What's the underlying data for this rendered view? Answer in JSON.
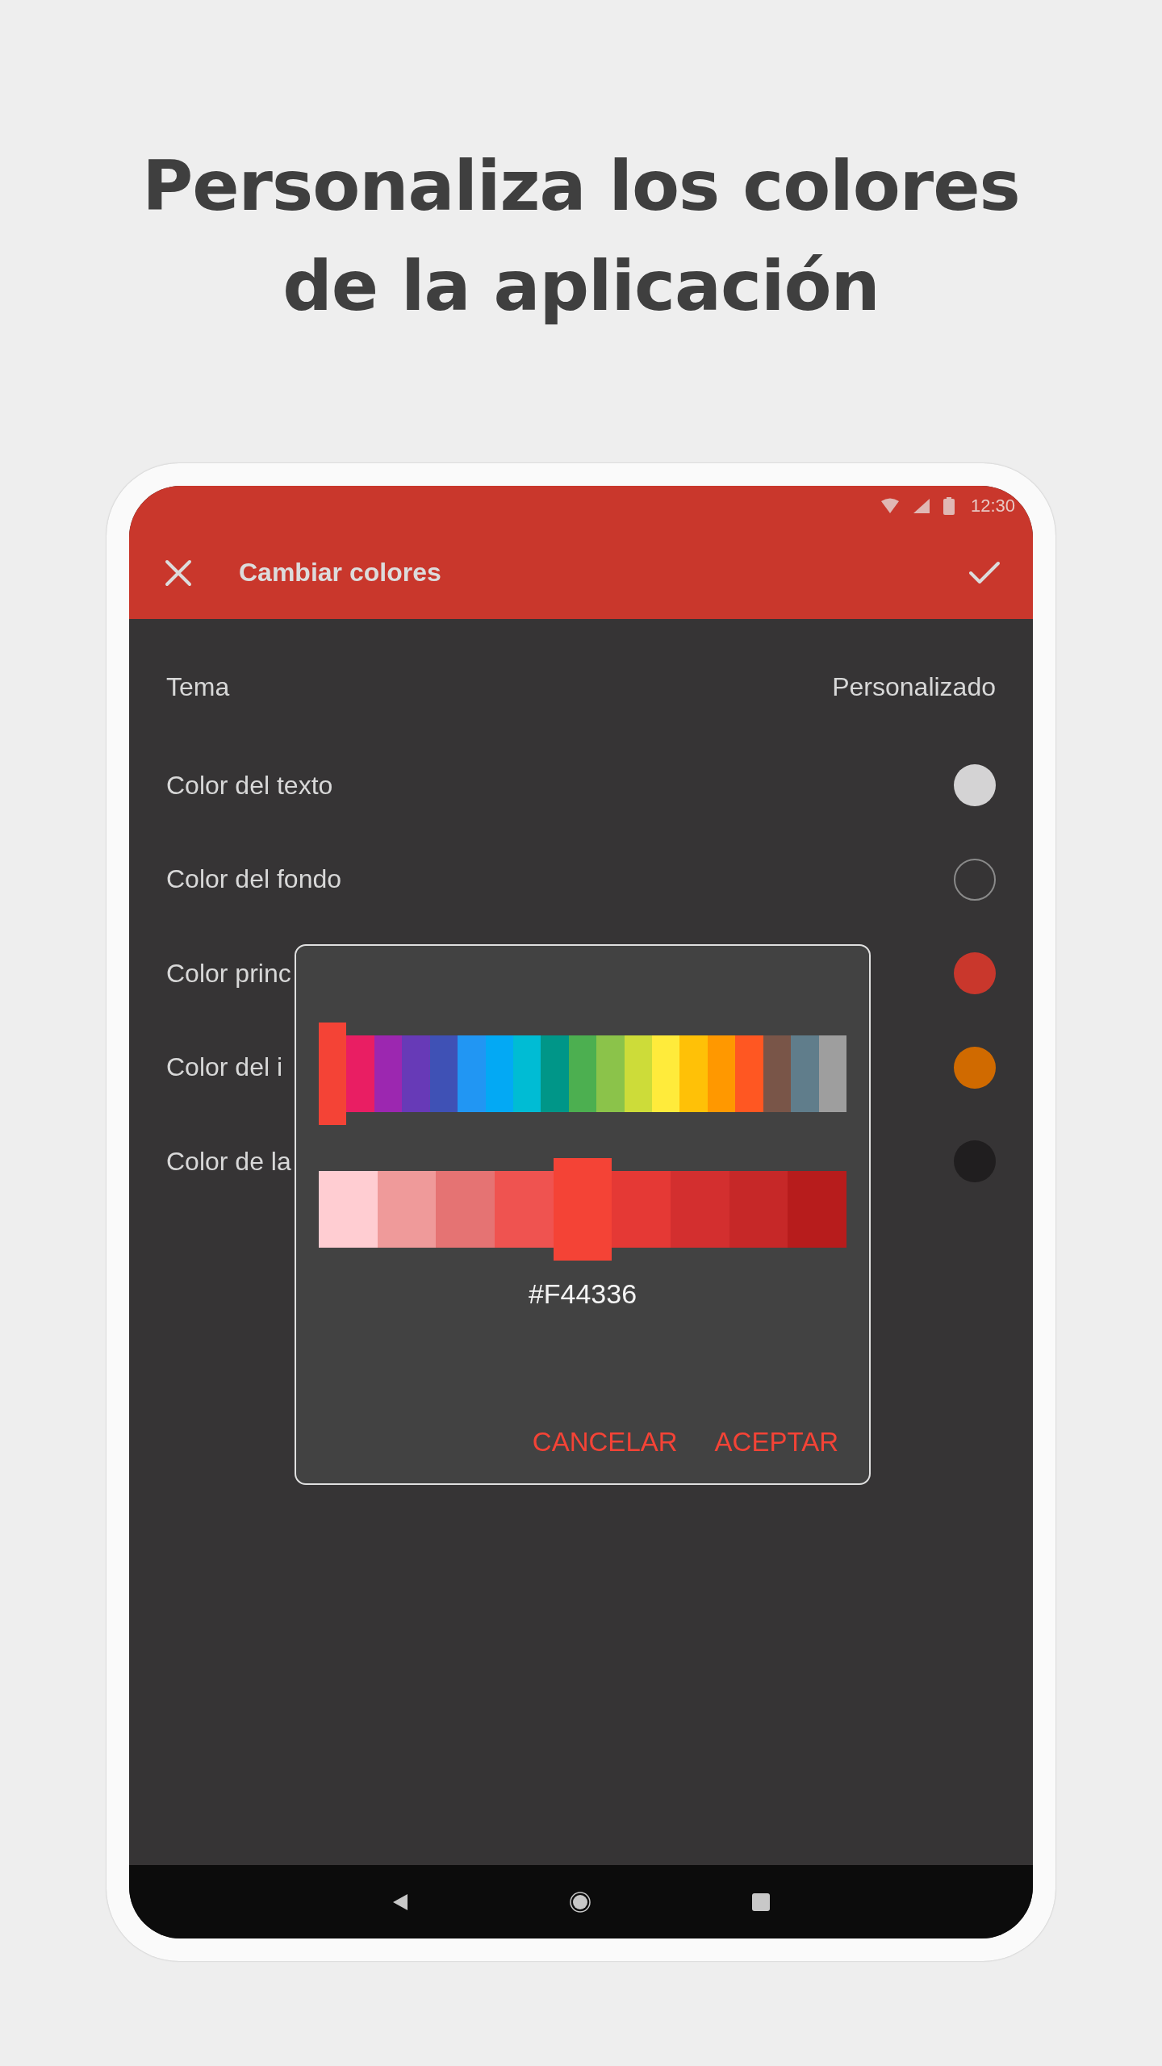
{
  "headline": "Personaliza los colores de la aplicación",
  "status_bar": {
    "time": "12:30"
  },
  "app_bar": {
    "title": "Cambiar colores"
  },
  "settings": [
    {
      "kind": "value",
      "label": "Tema",
      "value": "Personalizado"
    },
    {
      "kind": "swatch",
      "label": "Color del texto",
      "color": "#d4d3d4"
    },
    {
      "kind": "outline",
      "label": "Color del fondo",
      "color": "#363435"
    },
    {
      "kind": "swatch",
      "label": "Color princ",
      "color": "#c9372c"
    },
    {
      "kind": "swatch",
      "label": "Color del i",
      "color": "#d06a00"
    },
    {
      "kind": "swatch",
      "label": "Color de la",
      "color": "#201e1f"
    }
  ],
  "dialog": {
    "hues": [
      {
        "color": "#f44336",
        "selected": true
      },
      {
        "color": "#e91e63",
        "selected": false
      },
      {
        "color": "#9c27b0",
        "selected": false
      },
      {
        "color": "#673ab7",
        "selected": false
      },
      {
        "color": "#3f51b5",
        "selected": false
      },
      {
        "color": "#2196f3",
        "selected": false
      },
      {
        "color": "#03a9f4",
        "selected": false
      },
      {
        "color": "#00bcd4",
        "selected": false
      },
      {
        "color": "#009688",
        "selected": false
      },
      {
        "color": "#4caf50",
        "selected": false
      },
      {
        "color": "#8bc34a",
        "selected": false
      },
      {
        "color": "#cddc39",
        "selected": false
      },
      {
        "color": "#ffeb3b",
        "selected": false
      },
      {
        "color": "#ffc107",
        "selected": false
      },
      {
        "color": "#ff9800",
        "selected": false
      },
      {
        "color": "#ff5722",
        "selected": false
      },
      {
        "color": "#795548",
        "selected": false
      },
      {
        "color": "#607d8b",
        "selected": false
      },
      {
        "color": "#9e9e9e",
        "selected": false
      }
    ],
    "shades": [
      {
        "color": "#ffcdd2",
        "selected": false
      },
      {
        "color": "#ef9a9a",
        "selected": false
      },
      {
        "color": "#e57373",
        "selected": false
      },
      {
        "color": "#ef5350",
        "selected": false
      },
      {
        "color": "#f44336",
        "selected": true
      },
      {
        "color": "#e53935",
        "selected": false
      },
      {
        "color": "#d32f2f",
        "selected": false
      },
      {
        "color": "#c62828",
        "selected": false
      },
      {
        "color": "#b71c1c",
        "selected": false
      }
    ],
    "hex": "#F44336",
    "buttons": [
      "CANCELAR",
      "ACEPTAR"
    ]
  }
}
